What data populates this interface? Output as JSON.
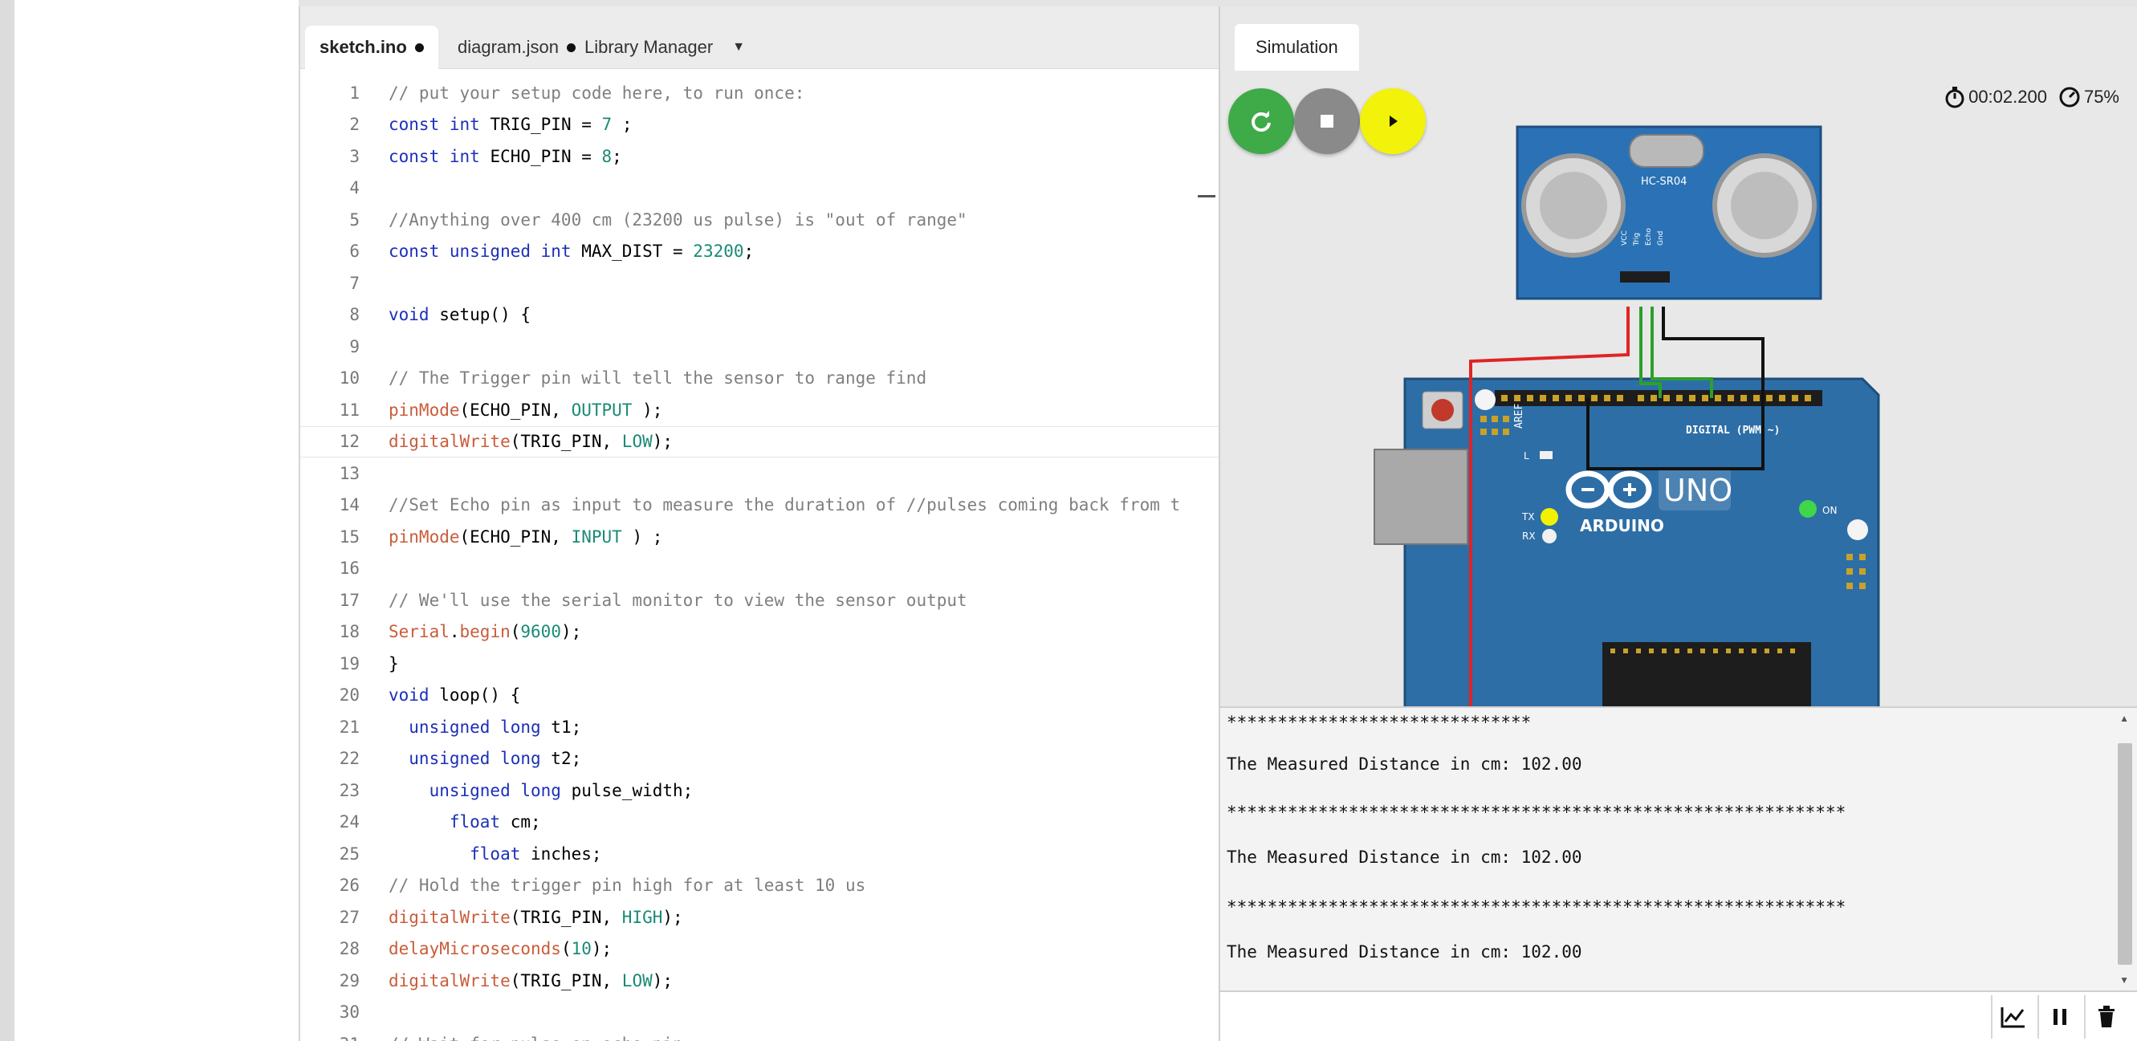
{
  "editor": {
    "tabs": [
      {
        "label": "sketch.ino",
        "modified": true
      },
      {
        "label": "diagram.json",
        "modified": true
      },
      {
        "label": "Library Manager"
      }
    ],
    "code_lines": [
      {
        "n": "1",
        "segments": [
          {
            "t": "// put your setup code here, to run once:",
            "c": "cm"
          }
        ]
      },
      {
        "n": "2",
        "segments": [
          {
            "t": "const int",
            "c": "kw"
          },
          {
            "t": " TRIG_PIN = ",
            "c": ""
          },
          {
            "t": "7",
            "c": "cn"
          },
          {
            "t": " ;",
            "c": ""
          }
        ]
      },
      {
        "n": "3",
        "segments": [
          {
            "t": "const int",
            "c": "kw"
          },
          {
            "t": " ECHO_PIN = ",
            "c": ""
          },
          {
            "t": "8",
            "c": "cn"
          },
          {
            "t": ";",
            "c": ""
          }
        ]
      },
      {
        "n": "4",
        "segments": []
      },
      {
        "n": "5",
        "segments": [
          {
            "t": "//Anything over 400 cm (23200 us pulse) is \"out of range\"",
            "c": "cm"
          }
        ]
      },
      {
        "n": "6",
        "segments": [
          {
            "t": "const unsigned int",
            "c": "kw"
          },
          {
            "t": " MAX_DIST = ",
            "c": ""
          },
          {
            "t": "23200",
            "c": "cn"
          },
          {
            "t": ";",
            "c": ""
          }
        ]
      },
      {
        "n": "7",
        "segments": []
      },
      {
        "n": "8",
        "segments": [
          {
            "t": "void",
            "c": "kw"
          },
          {
            "t": " setup() {",
            "c": ""
          }
        ]
      },
      {
        "n": "9",
        "segments": []
      },
      {
        "n": "10",
        "segments": [
          {
            "t": "// The Trigger pin will tell the sensor to range find",
            "c": "cm"
          }
        ]
      },
      {
        "n": "11",
        "segments": [
          {
            "t": "pinMode",
            "c": "fn"
          },
          {
            "t": "(ECHO_PIN, ",
            "c": ""
          },
          {
            "t": "OUTPUT",
            "c": "cn"
          },
          {
            "t": " );",
            "c": ""
          }
        ]
      },
      {
        "n": "12",
        "segments": [
          {
            "t": "digitalWrite",
            "c": "fn"
          },
          {
            "t": "(TRIG_PIN, ",
            "c": ""
          },
          {
            "t": "LOW",
            "c": "cn"
          },
          {
            "t": ");",
            "c": ""
          }
        ],
        "highlight": true
      },
      {
        "n": "13",
        "segments": []
      },
      {
        "n": "14",
        "segments": [
          {
            "t": "//Set Echo pin as input to measure the duration of //pulses coming back from t",
            "c": "cm"
          }
        ]
      },
      {
        "n": "15",
        "segments": [
          {
            "t": "pinMode",
            "c": "fn"
          },
          {
            "t": "(ECHO_PIN, ",
            "c": ""
          },
          {
            "t": "INPUT",
            "c": "cn"
          },
          {
            "t": " ) ;",
            "c": ""
          }
        ]
      },
      {
        "n": "16",
        "segments": []
      },
      {
        "n": "17",
        "segments": [
          {
            "t": "// We'll use the serial monitor to view the sensor output",
            "c": "cm"
          }
        ]
      },
      {
        "n": "18",
        "segments": [
          {
            "t": "Serial",
            "c": "fn"
          },
          {
            "t": ".",
            "c": ""
          },
          {
            "t": "begin",
            "c": "fn"
          },
          {
            "t": "(",
            "c": ""
          },
          {
            "t": "9600",
            "c": "cn"
          },
          {
            "t": ");",
            "c": ""
          }
        ]
      },
      {
        "n": "19",
        "segments": [
          {
            "t": "}",
            "c": ""
          }
        ]
      },
      {
        "n": "20",
        "segments": [
          {
            "t": "void",
            "c": "kw"
          },
          {
            "t": " loop() {",
            "c": ""
          }
        ]
      },
      {
        "n": "21",
        "segments": [
          {
            "t": "  unsigned long",
            "c": "kw"
          },
          {
            "t": " t1;",
            "c": ""
          }
        ]
      },
      {
        "n": "22",
        "segments": [
          {
            "t": "  unsigned long",
            "c": "kw"
          },
          {
            "t": " t2;",
            "c": ""
          }
        ]
      },
      {
        "n": "23",
        "segments": [
          {
            "t": "    unsigned long",
            "c": "kw"
          },
          {
            "t": " pulse_width;",
            "c": ""
          }
        ]
      },
      {
        "n": "24",
        "segments": [
          {
            "t": "      float",
            "c": "kw"
          },
          {
            "t": " cm;",
            "c": ""
          }
        ]
      },
      {
        "n": "25",
        "segments": [
          {
            "t": "        float",
            "c": "kw"
          },
          {
            "t": " inches;",
            "c": ""
          }
        ]
      },
      {
        "n": "26",
        "segments": [
          {
            "t": "// Hold the trigger pin high for at least 10 us",
            "c": "cm"
          }
        ]
      },
      {
        "n": "27",
        "segments": [
          {
            "t": "digitalWrite",
            "c": "fn"
          },
          {
            "t": "(TRIG_PIN, ",
            "c": ""
          },
          {
            "t": "HIGH",
            "c": "cn"
          },
          {
            "t": ");",
            "c": ""
          }
        ]
      },
      {
        "n": "28",
        "segments": [
          {
            "t": "delayMicroseconds",
            "c": "fn"
          },
          {
            "t": "(",
            "c": ""
          },
          {
            "t": "10",
            "c": "cn"
          },
          {
            "t": ");",
            "c": ""
          }
        ]
      },
      {
        "n": "29",
        "segments": [
          {
            "t": "digitalWrite",
            "c": "fn"
          },
          {
            "t": "(TRIG_PIN, ",
            "c": ""
          },
          {
            "t": "LOW",
            "c": "cn"
          },
          {
            "t": ");",
            "c": ""
          }
        ]
      },
      {
        "n": "30",
        "segments": []
      },
      {
        "n": "31",
        "segments": [
          {
            "t": "// Wait for pulse on echo pin",
            "c": "cm"
          }
        ]
      }
    ]
  },
  "simulation": {
    "tab_label": "Simulation",
    "controls": [
      {
        "name": "restart",
        "color": "#3faa48",
        "icon": "restart-icon"
      },
      {
        "name": "stop",
        "color": "#8a8a8a",
        "icon": "stop-icon"
      },
      {
        "name": "play",
        "color": "#f2f20a",
        "icon": "play-icon"
      }
    ],
    "timer": "00:02.200",
    "speed": "75%",
    "circuit": {
      "sensor_label": "HC-SR04",
      "board_label": "UNO",
      "board_brand": "ARDUINO",
      "digital_label": "DIGITAL (PWM ~)",
      "on_label": "ON",
      "tx_label": "TX",
      "rx_label": "RX",
      "l_label": "L",
      "aref_label": "AREF",
      "pin_labels": [
        "VCC",
        "Trig",
        "Echo",
        "Gnd"
      ]
    }
  },
  "serial_monitor": {
    "lines": [
      "******************************",
      "The Measured Distance in cm: 102.00",
      "*************************************************************",
      "The Measured Distance in cm: 102.00",
      "*************************************************************",
      "The Measured Distance in cm: 102.00",
      "***********************"
    ],
    "input_value": "",
    "buttons": [
      {
        "name": "plotter",
        "icon": "chart-icon"
      },
      {
        "name": "pause",
        "icon": "pause-icon"
      },
      {
        "name": "clear",
        "icon": "trash-icon"
      }
    ]
  },
  "colors": {
    "board_blue": "#2d6ea6",
    "sensor_blue": "#2a72b5",
    "wire_red": "#e02424",
    "wire_green": "#2ca02c",
    "wire_black": "#111111"
  }
}
